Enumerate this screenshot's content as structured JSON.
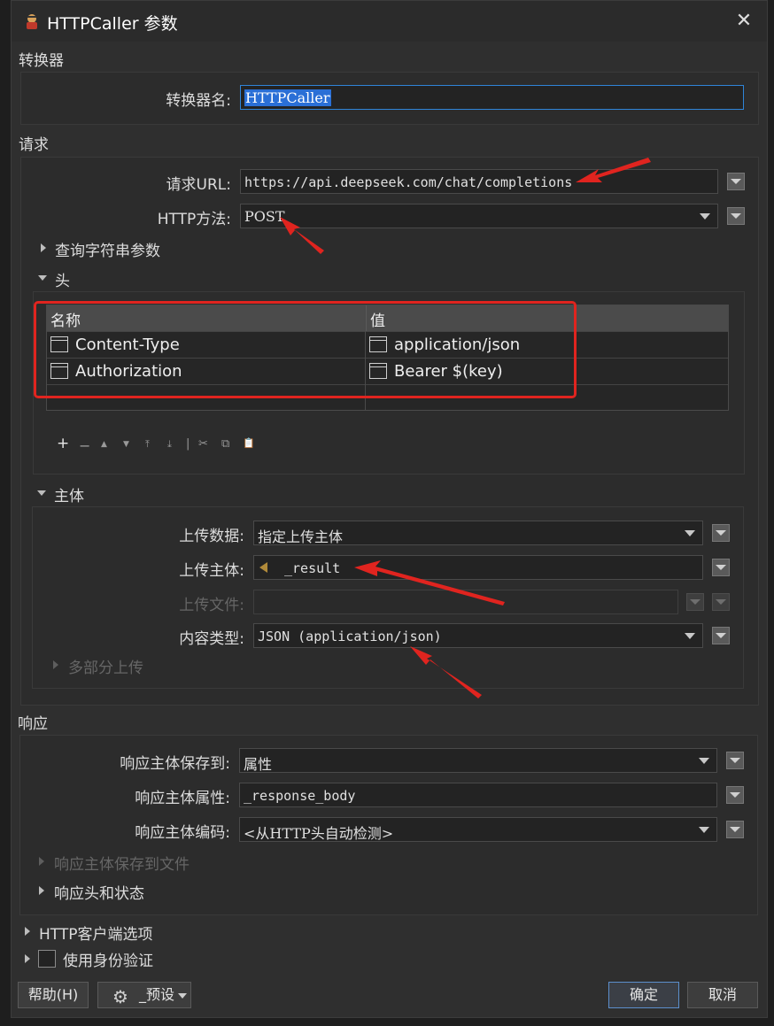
{
  "window": {
    "title": "HTTPCaller 参数",
    "close_icon": "close-icon"
  },
  "sections": {
    "transformer": "转换器",
    "request": "请求",
    "response": "响应"
  },
  "transformer": {
    "name_label": "转换器名:",
    "name_value": "HTTPCaller"
  },
  "request": {
    "url_label": "请求URL:",
    "url_value": "https://api.deepseek.com/chat/completions",
    "method_label": "HTTP方法:",
    "method_value": "POST",
    "query_params": "查询字符串参数",
    "headers": "头"
  },
  "headers_table": {
    "columns": [
      "名称",
      "值"
    ],
    "rows": [
      {
        "name": "Content-Type",
        "value": "application/json"
      },
      {
        "name": "Authorization",
        "value": "Bearer $(key)"
      }
    ],
    "toolbar": [
      "+",
      "−",
      "▲",
      "▼",
      "⤒",
      "⤓",
      "|",
      "✂",
      "⧉",
      "📋"
    ]
  },
  "body": {
    "title": "主体",
    "upload_data_label": "上传数据:",
    "upload_data_value": "指定上传主体",
    "upload_body_label": "上传主体:",
    "upload_body_value": "_result",
    "upload_file_label": "上传文件:",
    "content_type_label": "内容类型:",
    "content_type_value": "JSON (application/json)",
    "multipart": "多部分上传"
  },
  "response": {
    "save_to_label": "响应主体保存到:",
    "save_to_value": "属性",
    "attr_label": "响应主体属性:",
    "attr_value": "_response_body",
    "encoding_label": "响应主体编码:",
    "encoding_value": "<从HTTP头自动检测>",
    "save_to_file": "响应主体保存到文件",
    "headers_status": "响应头和状态"
  },
  "options": {
    "http_client": "HTTP客户端选项",
    "auth": "使用身份验证"
  },
  "footer": {
    "help": "帮助(H)",
    "preset": "_预设",
    "ok": "确定",
    "cancel": "取消"
  },
  "colors": {
    "annotation_red": "#e0241f",
    "focus_blue": "#2f84d8",
    "background": "#2f2f2f"
  }
}
